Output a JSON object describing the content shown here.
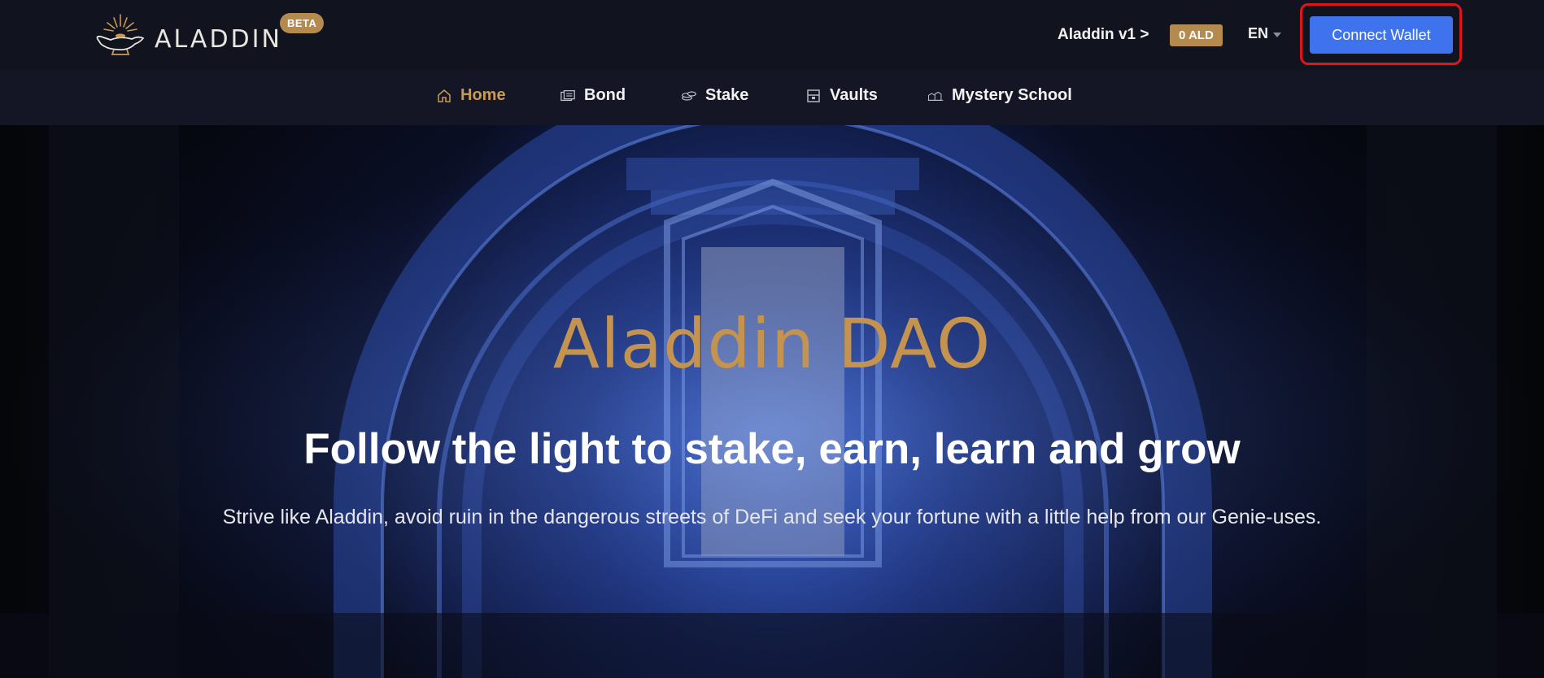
{
  "header": {
    "logo_text": "ALADDIN",
    "beta_label": "BETA",
    "version_link": "Aladdin v1 >",
    "ald_balance": "0 ALD",
    "language": "EN",
    "connect_wallet": "Connect Wallet"
  },
  "nav": {
    "items": [
      {
        "label": "Home",
        "icon": "home-icon",
        "active": true
      },
      {
        "label": "Bond",
        "icon": "bond-icon"
      },
      {
        "label": "Stake",
        "icon": "stake-icon"
      },
      {
        "label": "Vaults",
        "icon": "vault-icon"
      },
      {
        "label": "Mystery School",
        "icon": "school-icon"
      }
    ]
  },
  "hero": {
    "title": "Aladdin DAO",
    "subtitle": "Follow the light to stake, earn, learn and grow",
    "description": "Strive like Aladdin, avoid ruin in the dangerous streets of DeFi and seek your fortune with a little help from our Genie-uses."
  },
  "colors": {
    "accent_gold": "#c4934f",
    "button_blue": "#3f73ee",
    "highlight_red": "#e0141a",
    "header_bg": "#11131f"
  }
}
